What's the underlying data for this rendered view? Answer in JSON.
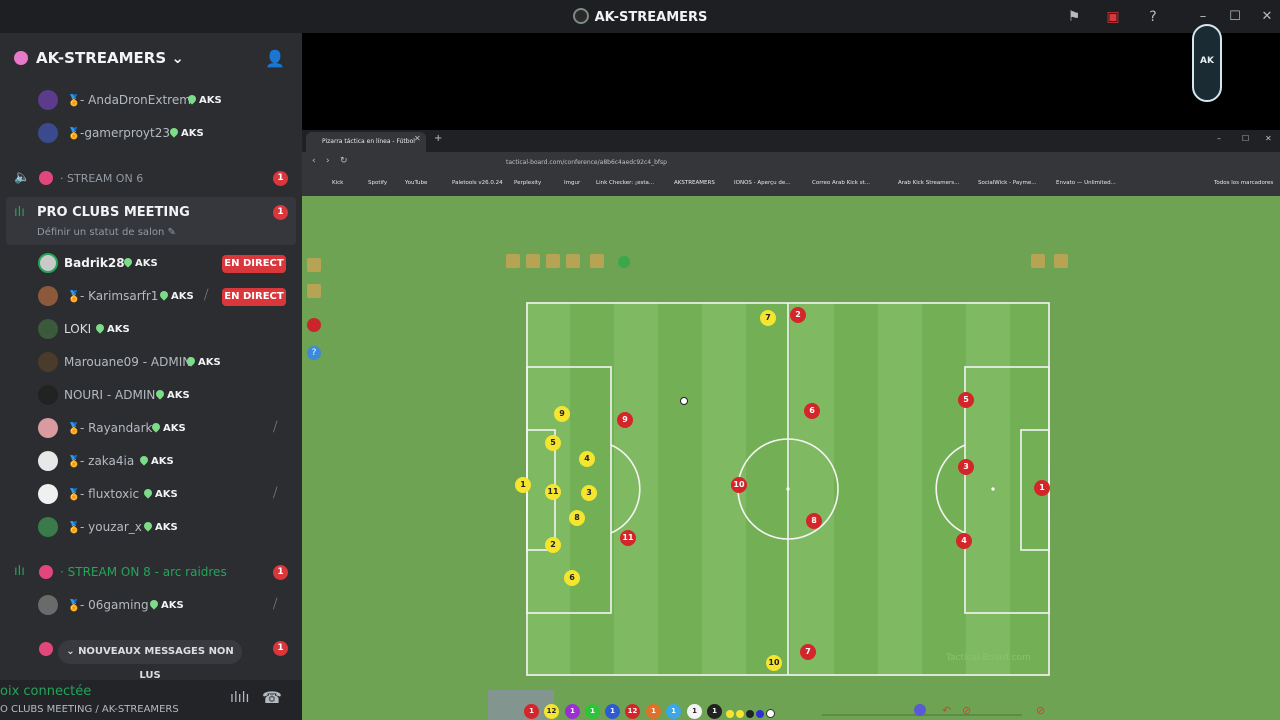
{
  "window": {
    "title": "AK-STREAMERS"
  },
  "server": {
    "name": "AK-STREAMERS"
  },
  "members_top": [
    {
      "name": "- AndaDronExtrem",
      "tag": "AKS"
    },
    {
      "name": "-gamerproyt23",
      "tag": "AKS"
    }
  ],
  "channel_stream6": {
    "name": "STREAM ON 6",
    "badge": "1"
  },
  "pro_channel": {
    "name": "PRO CLUBS MEETING",
    "status": "Définir un statut de salon",
    "badge": "1"
  },
  "pro_members": [
    {
      "name": "Badrik28",
      "tag": "AKS",
      "live": "EN DIRECT"
    },
    {
      "name": "- Karimsarfr1",
      "tag": "AKS",
      "live": "EN DIRECT"
    },
    {
      "name": "LOKI",
      "tag": "AKS"
    },
    {
      "name": "Marouane09 - ADMIN",
      "tag": "AKS"
    },
    {
      "name": "NOURI - ADMIN",
      "tag": "AKS"
    },
    {
      "name": "- Rayandark",
      "tag": "AKS"
    },
    {
      "name": "- zaka4ia",
      "tag": "AKS"
    },
    {
      "name": "- fluxtoxic",
      "tag": "AKS"
    },
    {
      "name": "- youzar_x",
      "tag": "AKS"
    }
  ],
  "channel_stream8": {
    "name": "STREAM ON 8 - arc raidres",
    "badge": "1"
  },
  "stream8_members": [
    {
      "name": "- 06gaming",
      "tag": "AKS"
    }
  ],
  "unread": {
    "label": "NOUVEAUX MESSAGES NON LUS",
    "badge": "1"
  },
  "voice": {
    "connected": "oix connectée",
    "channel": "O CLUBS MEETING / AK-STREAMERS"
  },
  "corner_logo": {
    "text": "AK"
  },
  "browser": {
    "tab_title": "Pizarra táctica en línea - Fútbol",
    "url": "tactical-board.com/conference/a8b6c4aedc92c4_bfsp",
    "bookmarks": [
      "Kick",
      "Spotify",
      "YouTube",
      "Paletools v26.0.24",
      "Perplexity",
      "Imgur",
      "Link Checker: ¡esta...",
      "AKSTREAMERS",
      "IONOS - Aperçu de...",
      "Correo Arab Kick st...",
      "Arab Kick Streamers...",
      "SocialWick - Payme...",
      "Envato — Unlimited...",
      "Todos los marcadores"
    ]
  },
  "tactic_board": {
    "yellow_team": [
      "9",
      "5",
      "4",
      "1",
      "11",
      "3",
      "8",
      "2",
      "6",
      "7",
      "10"
    ],
    "red_team": [
      "2",
      "9",
      "6",
      "10",
      "8",
      "11",
      "5",
      "3",
      "1",
      "4",
      "7"
    ],
    "palette": [
      "1",
      "12",
      "1",
      "1",
      "1",
      "12",
      "1",
      "1",
      "1",
      "1"
    ],
    "watermark": "Tactical-Board.com"
  },
  "colors": {
    "yellow": "#f5e52e",
    "red": "#d4262a",
    "pitch": "#79b45e",
    "live_badge": "#da373c",
    "accent_green": "#23a55a"
  }
}
